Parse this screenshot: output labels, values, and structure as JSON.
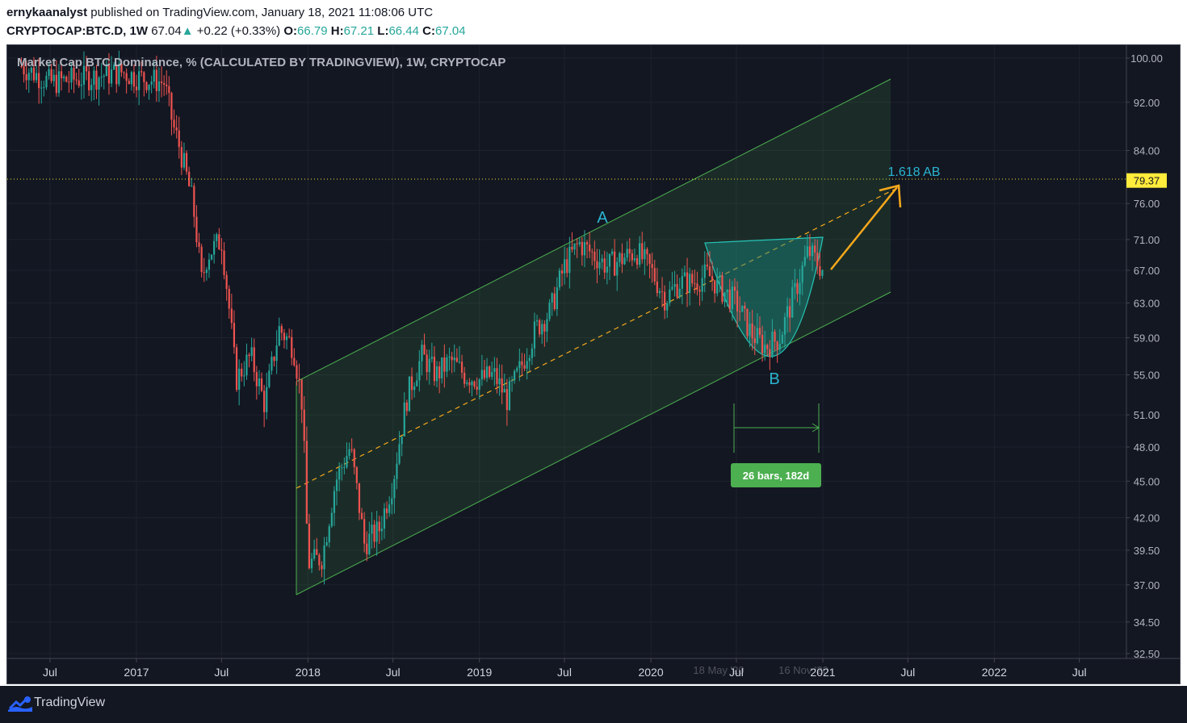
{
  "header": {
    "author": "ernykaanalyst",
    "published_text": "published on TradingView.com, January 18, 2021 11:08:06 UTC",
    "symbol": "CRYPTOCAP:BTC.D, 1W",
    "last": "67.04",
    "change_arrow": "▲",
    "change": "+0.22 (+0.33%)",
    "o_label": "O:",
    "o_value": "66.79",
    "h_label": "H:",
    "h_value": "67.21",
    "l_label": "L:",
    "l_value": "66.44",
    "c_label": "C:",
    "c_value": "67.04"
  },
  "footer": {
    "brand": "TradingView"
  },
  "colors": {
    "background": "#131722",
    "up": "#26a69a",
    "down": "#ef5350",
    "channel": "#4caf50",
    "cup": "#1b8a80",
    "arrow": "#f7a81b",
    "label_blue": "#2ab5d1",
    "price_tag": "#ffeb3b"
  },
  "chart_data": {
    "type": "candlestick",
    "title": "Market Cap BTC Dominance, % (CALCULATED BY TRADINGVIEW), 1W, CRYPTOCAP",
    "scale": "log",
    "ylim": [
      32.5,
      100
    ],
    "y_ticks": [
      "100.00",
      "92.00",
      "84.00",
      "79.37",
      "76.00",
      "71.00",
      "67.00",
      "63.00",
      "59.00",
      "55.00",
      "51.00",
      "48.00",
      "45.00",
      "42.00",
      "39.50",
      "37.00",
      "34.50",
      "32.50"
    ],
    "x_ticks": [
      "Jul",
      "2017",
      "Jul",
      "2018",
      "Jul",
      "2019",
      "Jul",
      "2020",
      "Jul",
      "2021",
      "Jul",
      "2022",
      "Jul"
    ],
    "current_price_tag": "79.37",
    "series": [
      {
        "date": "2016-05",
        "close": 98.5
      },
      {
        "date": "2016-07",
        "close": 95.5
      },
      {
        "date": "2016-10",
        "close": 96.5
      },
      {
        "date": "2016-12",
        "close": 97.4
      },
      {
        "date": "2017-01",
        "close": 96.5
      },
      {
        "date": "2017-03",
        "close": 95.5
      },
      {
        "date": "2017-03-20",
        "close": 88.0
      },
      {
        "date": "2017-04",
        "close": 85.0
      },
      {
        "date": "2017-05",
        "close": 76.0
      },
      {
        "date": "2017-05-20",
        "close": 65.5
      },
      {
        "date": "2017-06",
        "close": 69.0
      },
      {
        "date": "2017-07",
        "close": 71.0
      },
      {
        "date": "2017-08",
        "close": 54.5
      },
      {
        "date": "2017-09",
        "close": 57.0
      },
      {
        "date": "2017-10",
        "close": 52.0
      },
      {
        "date": "2017-11",
        "close": 60.0
      },
      {
        "date": "2017-12",
        "close": 58.0
      },
      {
        "date": "2017-12-20",
        "close": 52.0
      },
      {
        "date": "2018-01",
        "close": 38.5
      },
      {
        "date": "2018-02",
        "close": 39.0
      },
      {
        "date": "2018-03",
        "close": 45.0
      },
      {
        "date": "2018-04",
        "close": 48.0
      },
      {
        "date": "2018-05",
        "close": 40.0
      },
      {
        "date": "2018-06",
        "close": 41.0
      },
      {
        "date": "2018-07",
        "close": 45.0
      },
      {
        "date": "2018-08",
        "close": 53.0
      },
      {
        "date": "2018-09",
        "close": 57.0
      },
      {
        "date": "2018-10",
        "close": 55.0
      },
      {
        "date": "2018-11",
        "close": 56.5
      },
      {
        "date": "2018-12",
        "close": 55.0
      },
      {
        "date": "2019-01",
        "close": 54.5
      },
      {
        "date": "2019-02",
        "close": 55.0
      },
      {
        "date": "2019-03",
        "close": 52.5
      },
      {
        "date": "2019-04",
        "close": 56.0
      },
      {
        "date": "2019-05",
        "close": 60.0
      },
      {
        "date": "2019-06",
        "close": 62.0
      },
      {
        "date": "2019-07",
        "close": 67.5
      },
      {
        "date": "2019-08",
        "close": 70.5
      },
      {
        "date": "2019-09",
        "close": 69.0
      },
      {
        "date": "2019-10",
        "close": 67.5
      },
      {
        "date": "2019-11",
        "close": 68.5
      },
      {
        "date": "2019-12",
        "close": 69.5
      },
      {
        "date": "2020-01",
        "close": 67.0
      },
      {
        "date": "2020-02",
        "close": 63.5
      },
      {
        "date": "2020-03",
        "close": 65.5
      },
      {
        "date": "2020-04",
        "close": 65.5
      },
      {
        "date": "2020-05",
        "close": 66.5
      },
      {
        "date": "2020-06",
        "close": 64.5
      },
      {
        "date": "2020-07",
        "close": 63.0
      },
      {
        "date": "2020-08",
        "close": 59.5
      },
      {
        "date": "2020-09",
        "close": 58.0
      },
      {
        "date": "2020-10",
        "close": 59.0
      },
      {
        "date": "2020-11",
        "close": 64.0
      },
      {
        "date": "2020-12",
        "close": 69.5
      },
      {
        "date": "2021-01",
        "close": 67.04
      }
    ],
    "annotations": {
      "label_a": "A",
      "label_b": "B",
      "fib_label": "1.618 AB",
      "range_label": "26 bars, 182d",
      "range_start": "18 May '20",
      "range_end": "16 Nov '20"
    }
  }
}
